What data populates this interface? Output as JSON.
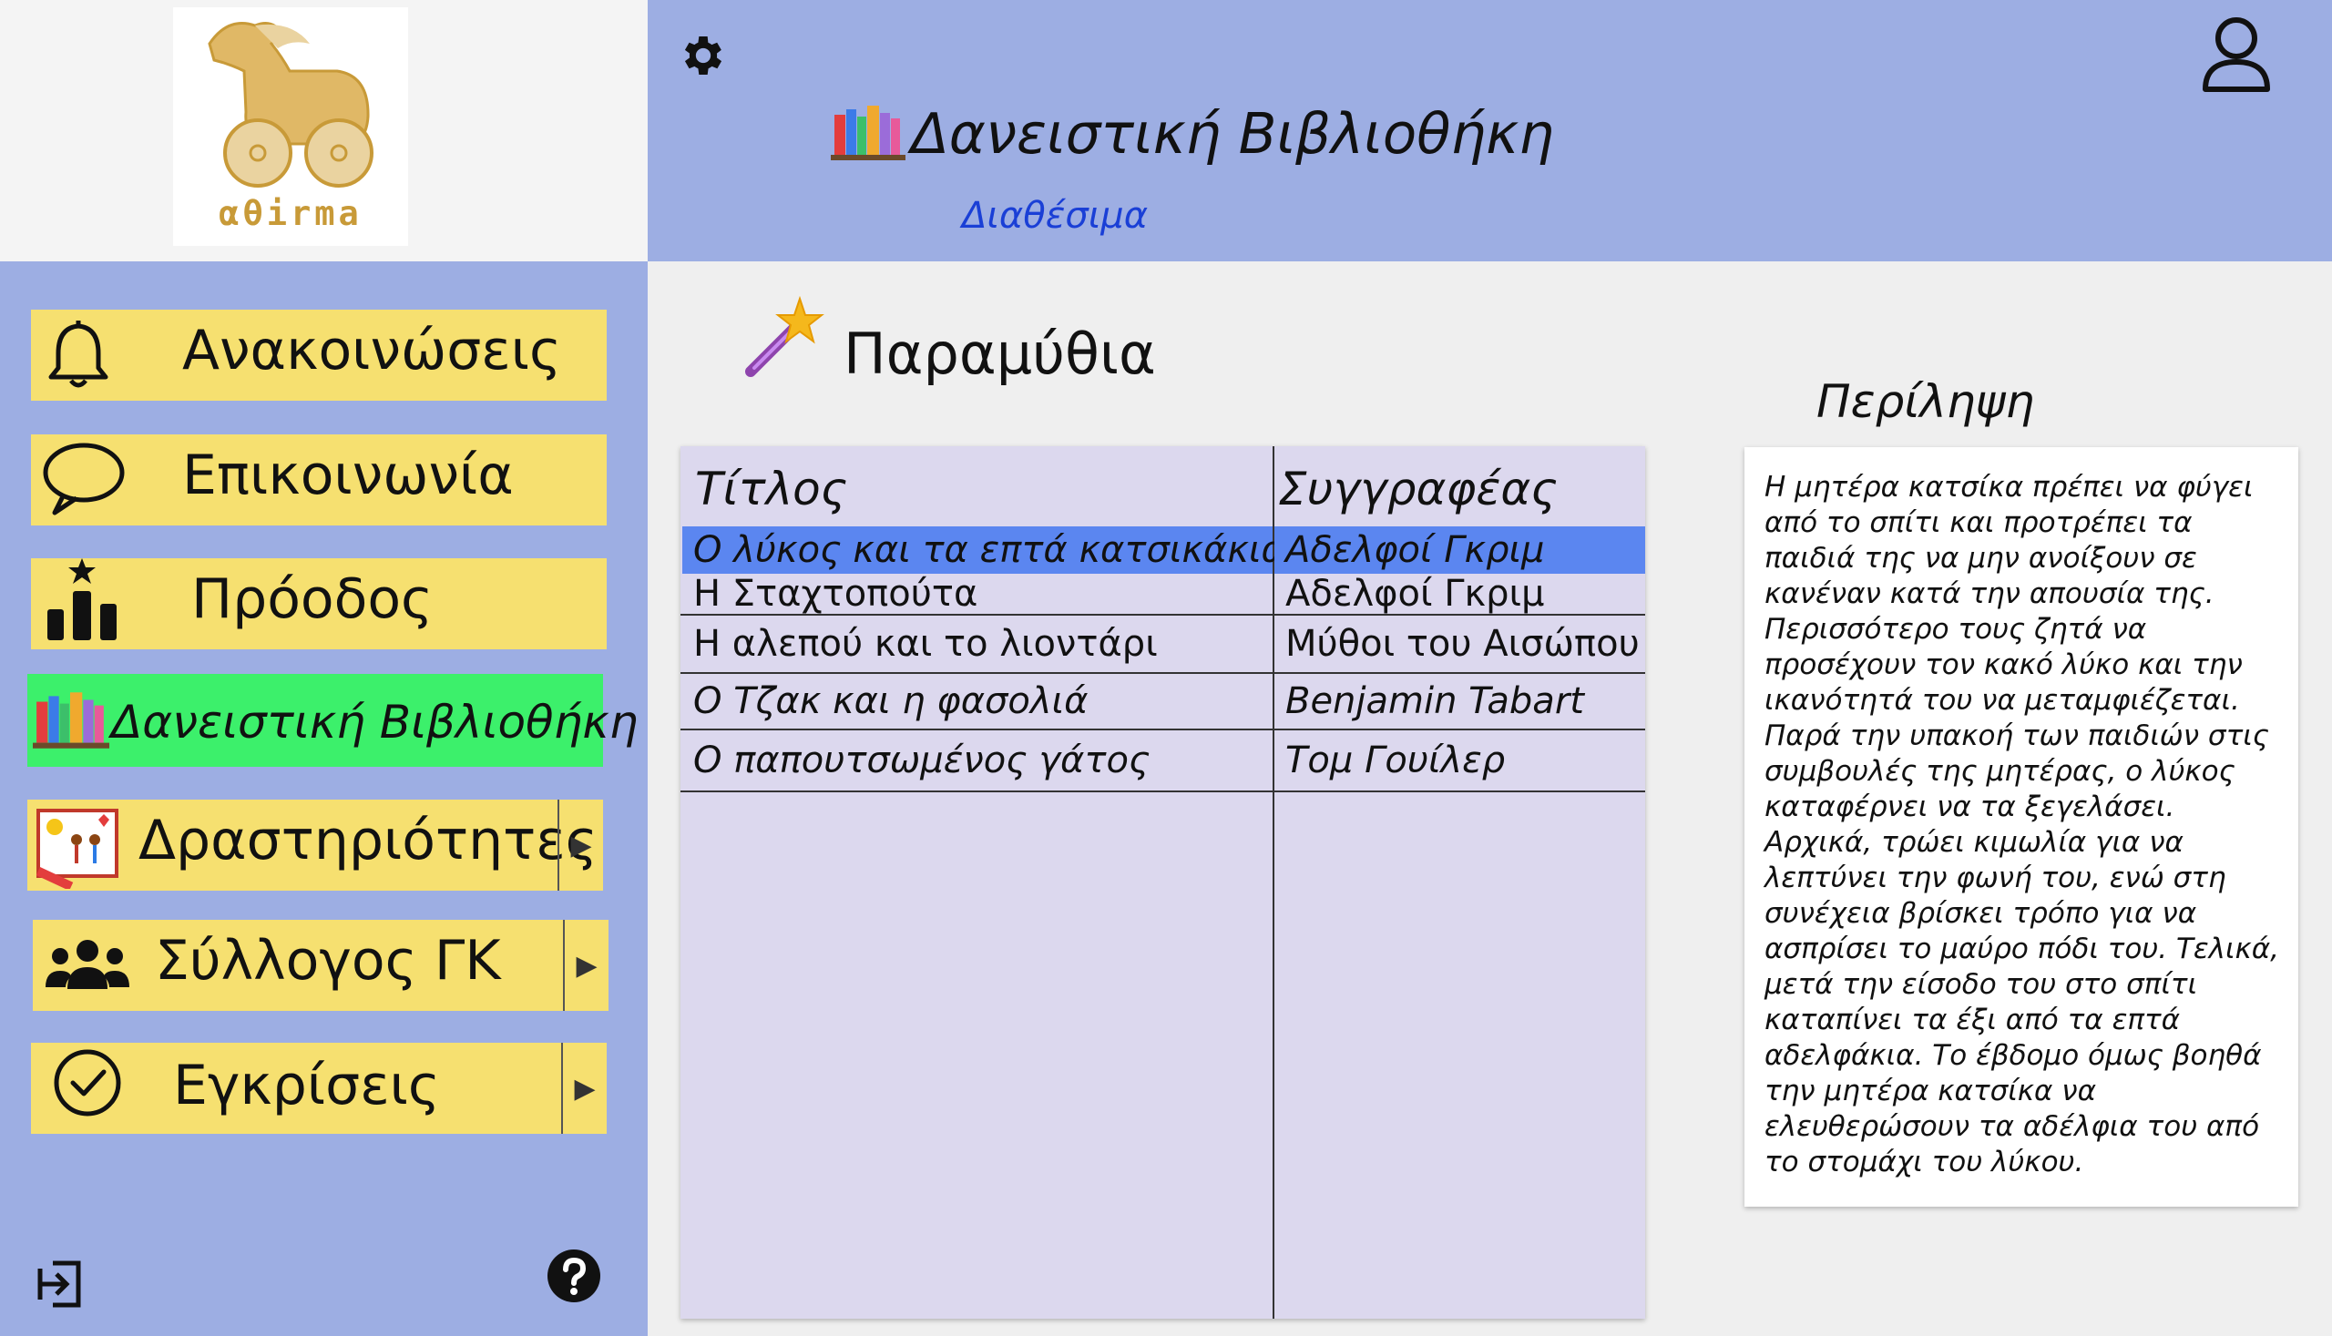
{
  "brand": {
    "logo_text": "αθirma"
  },
  "header": {
    "settings_icon": "gear-icon",
    "user_icon": "user-icon",
    "title": "Δανειστική Βιβλιοθήκη",
    "available_link": "Διαθέσιμα"
  },
  "sidebar": {
    "items": [
      {
        "label": "Ανακοινώσεις",
        "icon": "bell-icon"
      },
      {
        "label": "Επικοινωνία",
        "icon": "chat-bubble-icon"
      },
      {
        "label": "Πρόοδος",
        "icon": "progress-podium-icon"
      },
      {
        "label": "Δανειστική Βιβλιοθήκη",
        "icon": "books-icon",
        "active": true
      },
      {
        "label": "Δραστηριότητες",
        "icon": "activities-picture-icon",
        "has_submenu": true
      },
      {
        "label": "Σύλλογος ΓΚ",
        "icon": "people-group-icon",
        "has_submenu": true
      },
      {
        "label": "Εγκρίσεις",
        "icon": "check-circle-icon",
        "has_submenu": true
      }
    ],
    "logout_icon": "logout-icon",
    "help_icon": "help-icon",
    "submenu_arrow": "▶"
  },
  "main": {
    "category_title": "Παραμύθια",
    "category_icon": "magic-wand-icon",
    "table": {
      "headers": {
        "title": "Τίτλος",
        "author": "Συγγραφέας"
      },
      "rows": [
        {
          "title": "Ο λύκος και τα επτά κατσικάκια",
          "author": "Αδελφοί Γκριμ",
          "selected": true
        },
        {
          "title": "Η Σταχτοπούτα",
          "author": "Αδελφοί Γκριμ"
        },
        {
          "title": "Η αλεπού και το λιοντάρι",
          "author": "Μύθοι του Αισώπου"
        },
        {
          "title": "Ο Τζακ και η φασολιά",
          "author": "Benjamin Tabart"
        },
        {
          "title": "Ο παπουτσωμένος γάτος",
          "author": "Τομ Γουίλερ"
        }
      ]
    },
    "summary": {
      "title": "Περίληψη",
      "text": "Η μητέρα κατσίκα πρέπει να φύγει από το σπίτι και προτρέπει τα παιδιά της να μην ανοίξουν σε κανέναν κατά την απουσία της. Περισσότερο τους ζητά να προσέχουν τον κακό λύκο και την ικανότητά του να μεταμφιέζεται. Παρά την υπακοή των παιδιών στις συμβουλές της μητέρας, ο λύκος καταφέρνει να τα ξεγελάσει. Αρχικά, τρώει κιμωλία για να λεπτύνει την φωνή του, ενώ στη συνέχεια βρίσκει τρόπο για να ασπρίσει το μαύρο πόδι του. Τελικά, μετά την είσοδο του στο σπίτι καταπίνει τα έξι από τα επτά αδελφάκια. Το έβδομο όμως βοηθά την μητέρα κατσίκα να ελευθερώσουν τα αδέλφια του από το στομάχι του λύκου."
    }
  }
}
